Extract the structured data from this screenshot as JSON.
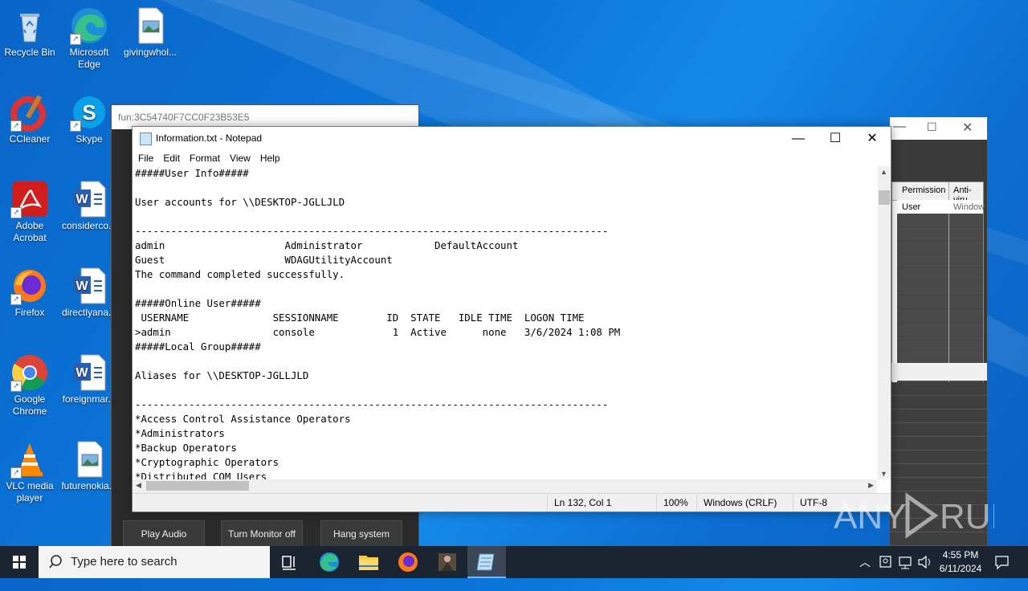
{
  "desktop": {
    "icons": [
      {
        "label": "Recycle Bin"
      },
      {
        "label": "Microsoft Edge"
      },
      {
        "label": "givingwhol..."
      },
      {
        "label": "CCleaner"
      },
      {
        "label": "Skype"
      },
      {
        "label": "Adobe Acrobat"
      },
      {
        "label": "considerco..."
      },
      {
        "label": "Firefox"
      },
      {
        "label": "directlyana..."
      },
      {
        "label": "Google Chrome"
      },
      {
        "label": "foreignmar..."
      },
      {
        "label": "VLC media player"
      },
      {
        "label": "futurenokia..."
      }
    ]
  },
  "bg_window": {
    "title": "fun:3C54740F7CC0F23B53E5",
    "buttons": [
      "Play Audio",
      "Turn Monitor off",
      "Hang system"
    ]
  },
  "right_window": {
    "col1": "Permission",
    "col2": "Anti-viru",
    "row1_c1": "User",
    "row1_c2": "Window"
  },
  "notepad": {
    "title": "Information.txt - Notepad",
    "menu": [
      "File",
      "Edit",
      "Format",
      "View",
      "Help"
    ],
    "lines": [
      "#####User Info#####",
      "",
      "User accounts for \\\\DESKTOP-JGLLJLD",
      "",
      "-------------------------------------------------------------------------------",
      "admin                    Administrator            DefaultAccount",
      "Guest                    WDAGUtilityAccount",
      "The command completed successfully.",
      "",
      "#####Online User#####",
      " USERNAME              SESSIONNAME        ID  STATE   IDLE TIME  LOGON TIME",
      ">admin                 console             1  Active      none   3/6/2024 1:08 PM",
      "#####Local Group#####",
      "",
      "Aliases for \\\\DESKTOP-JGLLJLD",
      "",
      "-------------------------------------------------------------------------------",
      "*Access Control Assistance Operators",
      "*Administrators",
      "*Backup Operators",
      "*Cryptographic Operators",
      "*Distributed COM Users"
    ],
    "status": {
      "position": "Ln 132, Col 1",
      "zoom": "100%",
      "eol": "Windows (CRLF)",
      "encoding": "UTF-8"
    }
  },
  "taskbar": {
    "search_placeholder": "Type here to search",
    "time": "4:55 PM",
    "date": "6/11/2024"
  },
  "watermark": "ANY RUN"
}
